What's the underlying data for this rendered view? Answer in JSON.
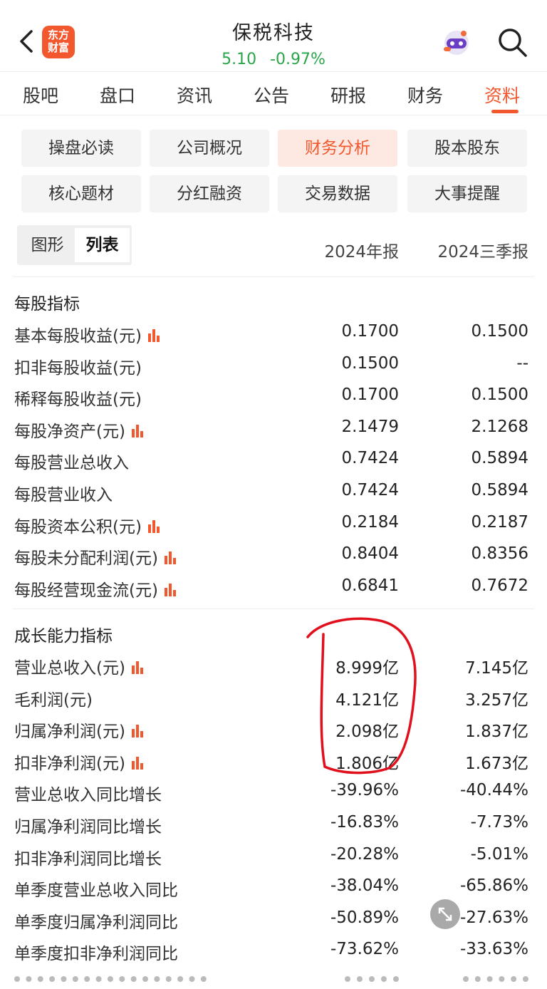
{
  "header": {
    "logo_line1": "东方",
    "logo_line2": "财富",
    "stock_name": "保税科技",
    "price": "5.10",
    "change": "-0.97%"
  },
  "tabs": [
    {
      "label": "股吧"
    },
    {
      "label": "盘口"
    },
    {
      "label": "资讯"
    },
    {
      "label": "公告"
    },
    {
      "label": "研报"
    },
    {
      "label": "财务"
    },
    {
      "label": "资料"
    }
  ],
  "active_tab": "资料",
  "sub_buttons": [
    {
      "label": "操盘必读"
    },
    {
      "label": "公司概况"
    },
    {
      "label": "财务分析"
    },
    {
      "label": "股本股东"
    },
    {
      "label": "核心题材"
    },
    {
      "label": "分红融资"
    },
    {
      "label": "交易数据"
    },
    {
      "label": "大事提醒"
    }
  ],
  "active_sub_button": "财务分析",
  "view_toggle": {
    "chart": "图形",
    "list": "列表",
    "active": "列表"
  },
  "periods": [
    "2024年报",
    "2024三季报"
  ],
  "per_share": {
    "title": "每股指标",
    "rows": [
      {
        "label": "基本每股收益(元)",
        "v1": "0.1700",
        "v2": "0.1500",
        "chart": true
      },
      {
        "label": "扣非每股收益(元)",
        "v1": "0.1500",
        "v2": "--",
        "chart": false
      },
      {
        "label": "稀释每股收益(元)",
        "v1": "0.1700",
        "v2": "0.1500",
        "chart": false
      },
      {
        "label": "每股净资产(元)",
        "v1": "2.1479",
        "v2": "2.1268",
        "chart": true
      },
      {
        "label": "每股营业总收入",
        "v1": "0.7424",
        "v2": "0.5894",
        "chart": false
      },
      {
        "label": "每股营业收入",
        "v1": "0.7424",
        "v2": "0.5894",
        "chart": false
      },
      {
        "label": "每股资本公积(元)",
        "v1": "0.2184",
        "v2": "0.2187",
        "chart": true
      },
      {
        "label": "每股未分配利润(元)",
        "v1": "0.8404",
        "v2": "0.8356",
        "chart": true
      },
      {
        "label": "每股经营现金流(元)",
        "v1": "0.6841",
        "v2": "0.7672",
        "chart": true
      }
    ]
  },
  "growth": {
    "title": "成长能力指标",
    "rows": [
      {
        "label": "营业总收入(元)",
        "v1": "8.999亿",
        "v2": "7.145亿",
        "chart": true
      },
      {
        "label": "毛利润(元)",
        "v1": "4.121亿",
        "v2": "3.257亿",
        "chart": false
      },
      {
        "label": "归属净利润(元)",
        "v1": "2.098亿",
        "v2": "1.837亿",
        "chart": true
      },
      {
        "label": "扣非净利润(元)",
        "v1": "1.806亿",
        "v2": "1.673亿",
        "chart": true
      },
      {
        "label": "营业总收入同比增长",
        "v1": "-39.96%",
        "v2": "-40.44%",
        "chart": false
      },
      {
        "label": "归属净利润同比增长",
        "v1": "-16.83%",
        "v2": "-7.73%",
        "chart": false
      },
      {
        "label": "扣非净利润同比增长",
        "v1": "-20.28%",
        "v2": "-5.01%",
        "chart": false
      },
      {
        "label": "单季度营业总收入同比",
        "v1": "-38.04%",
        "v2": "-65.86%",
        "chart": false
      },
      {
        "label": "单季度归属净利润同比",
        "v1": "-50.89%",
        "v2": "-27.63%",
        "chart": false
      },
      {
        "label": "单季度扣非净利润同比",
        "v1": "-73.62%",
        "v2": "-33.63%",
        "chart": false
      }
    ]
  },
  "colors": {
    "accent": "#f2572d",
    "down": "#2aa54a",
    "annotation": "#e0101c"
  }
}
